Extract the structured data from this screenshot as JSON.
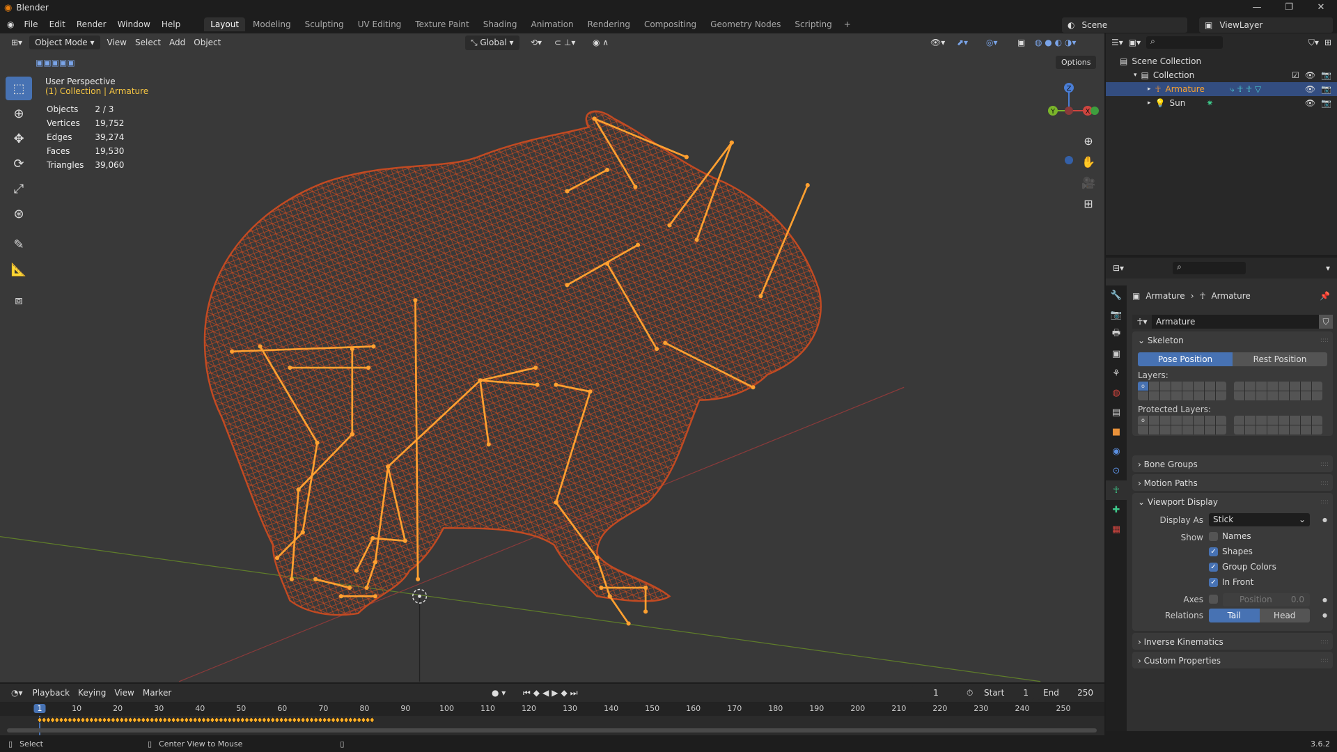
{
  "app": {
    "title": "Blender",
    "version": "3.6.2"
  },
  "menu": [
    "File",
    "Edit",
    "Render",
    "Window",
    "Help"
  ],
  "workspaces": [
    "Layout",
    "Modeling",
    "Sculpting",
    "UV Editing",
    "Texture Paint",
    "Shading",
    "Animation",
    "Rendering",
    "Compositing",
    "Geometry Nodes",
    "Scripting"
  ],
  "active_workspace": "Layout",
  "scene": {
    "name": "Scene",
    "view_layer": "ViewLayer"
  },
  "viewport": {
    "mode": "Object Mode",
    "menus": [
      "View",
      "Select",
      "Add",
      "Object"
    ],
    "orientation": "Global",
    "options": "Options",
    "perspective": "User Perspective",
    "context": "(1) Collection | Armature",
    "stats": [
      {
        "k": "Objects",
        "v": "2 / 3"
      },
      {
        "k": "Vertices",
        "v": "19,752"
      },
      {
        "k": "Edges",
        "v": "39,274"
      },
      {
        "k": "Faces",
        "v": "19,530"
      },
      {
        "k": "Triangles",
        "v": "39,060"
      }
    ],
    "gizmo": {
      "z": "Z",
      "y": "Y",
      "x": "X"
    },
    "mesh_color": "#c24a22",
    "bone_color": "#ffa030"
  },
  "tools": [
    "select-box-icon",
    "cursor-icon",
    "move-icon",
    "rotate-icon",
    "scale-icon",
    "transform-icon",
    "annotate-icon",
    "measure-icon",
    "add-cube-icon"
  ],
  "outliner": {
    "items": [
      {
        "label": "Scene Collection",
        "depth": 0,
        "icon": "collection-icon"
      },
      {
        "label": "Collection",
        "depth": 1,
        "icon": "collection-icon"
      },
      {
        "label": "Armature",
        "depth": 2,
        "icon": "armature-icon",
        "selected": true
      },
      {
        "label": "Sun",
        "depth": 2,
        "icon": "light-icon"
      }
    ]
  },
  "properties": {
    "breadcrumb": [
      "Armature",
      "Armature"
    ],
    "data_name": "Armature",
    "skeleton": {
      "title": "Skeleton",
      "pose": "Pose Position",
      "rest": "Rest Position",
      "active": "Pose Position",
      "layers": "Layers:",
      "protected": "Protected Layers:"
    },
    "collapsed": [
      "Bone Groups",
      "Motion Paths"
    ],
    "viewport_display": {
      "title": "Viewport Display",
      "display_as_label": "Display As",
      "display_as": "Stick",
      "show_label": "Show",
      "show": [
        {
          "label": "Names",
          "checked": false
        },
        {
          "label": "Shapes",
          "checked": true
        },
        {
          "label": "Group Colors",
          "checked": true
        },
        {
          "label": "In Front",
          "checked": true
        }
      ],
      "axes_label": "Axes",
      "axes_checked": false,
      "position_label": "Position",
      "position_value": "0.0",
      "relations_label": "Relations",
      "relations": [
        "Tail",
        "Head"
      ],
      "relations_active": "Tail"
    },
    "bottom": [
      "Inverse Kinematics",
      "Custom Properties"
    ]
  },
  "timeline": {
    "menus": [
      "Playback",
      "Keying",
      "View",
      "Marker"
    ],
    "current_frame": "1",
    "start_label": "Start",
    "start": "1",
    "end_label": "End",
    "end": "250",
    "ticks": [
      "1",
      "10",
      "20",
      "30",
      "40",
      "50",
      "60",
      "70",
      "80",
      "90",
      "100",
      "110",
      "120",
      "130",
      "140",
      "150",
      "160",
      "170",
      "180",
      "190",
      "200",
      "210",
      "220",
      "230",
      "240",
      "250"
    ],
    "key_color": "#ffb028"
  },
  "status": {
    "select": "Select",
    "center": "Center View to Mouse"
  }
}
